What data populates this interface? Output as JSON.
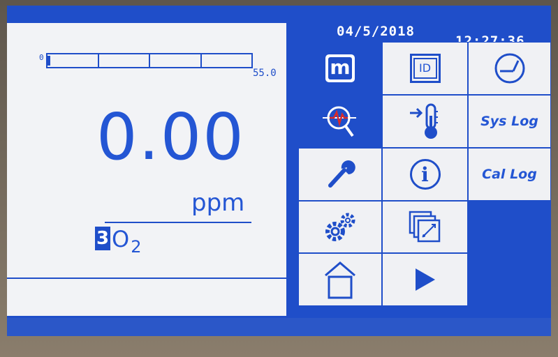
{
  "header": {
    "date": "04/5/2018",
    "time": "12:27:36"
  },
  "bargraph": {
    "min_label": "0",
    "max_label": "55.0"
  },
  "measurement": {
    "value": "0.00",
    "unit": "ppm",
    "channel": "3",
    "gas_main": "O",
    "gas_sub": "2"
  },
  "menu": {
    "sys_log_label": "Sys Log",
    "cal_log_label": "Cal Log",
    "id_label": "ID",
    "m_label": "m",
    "info_label": "i"
  },
  "colors": {
    "screen_blue": "#1f4ec9",
    "tile_bg": "#f0f1f4",
    "text_blue": "#2456d4"
  }
}
